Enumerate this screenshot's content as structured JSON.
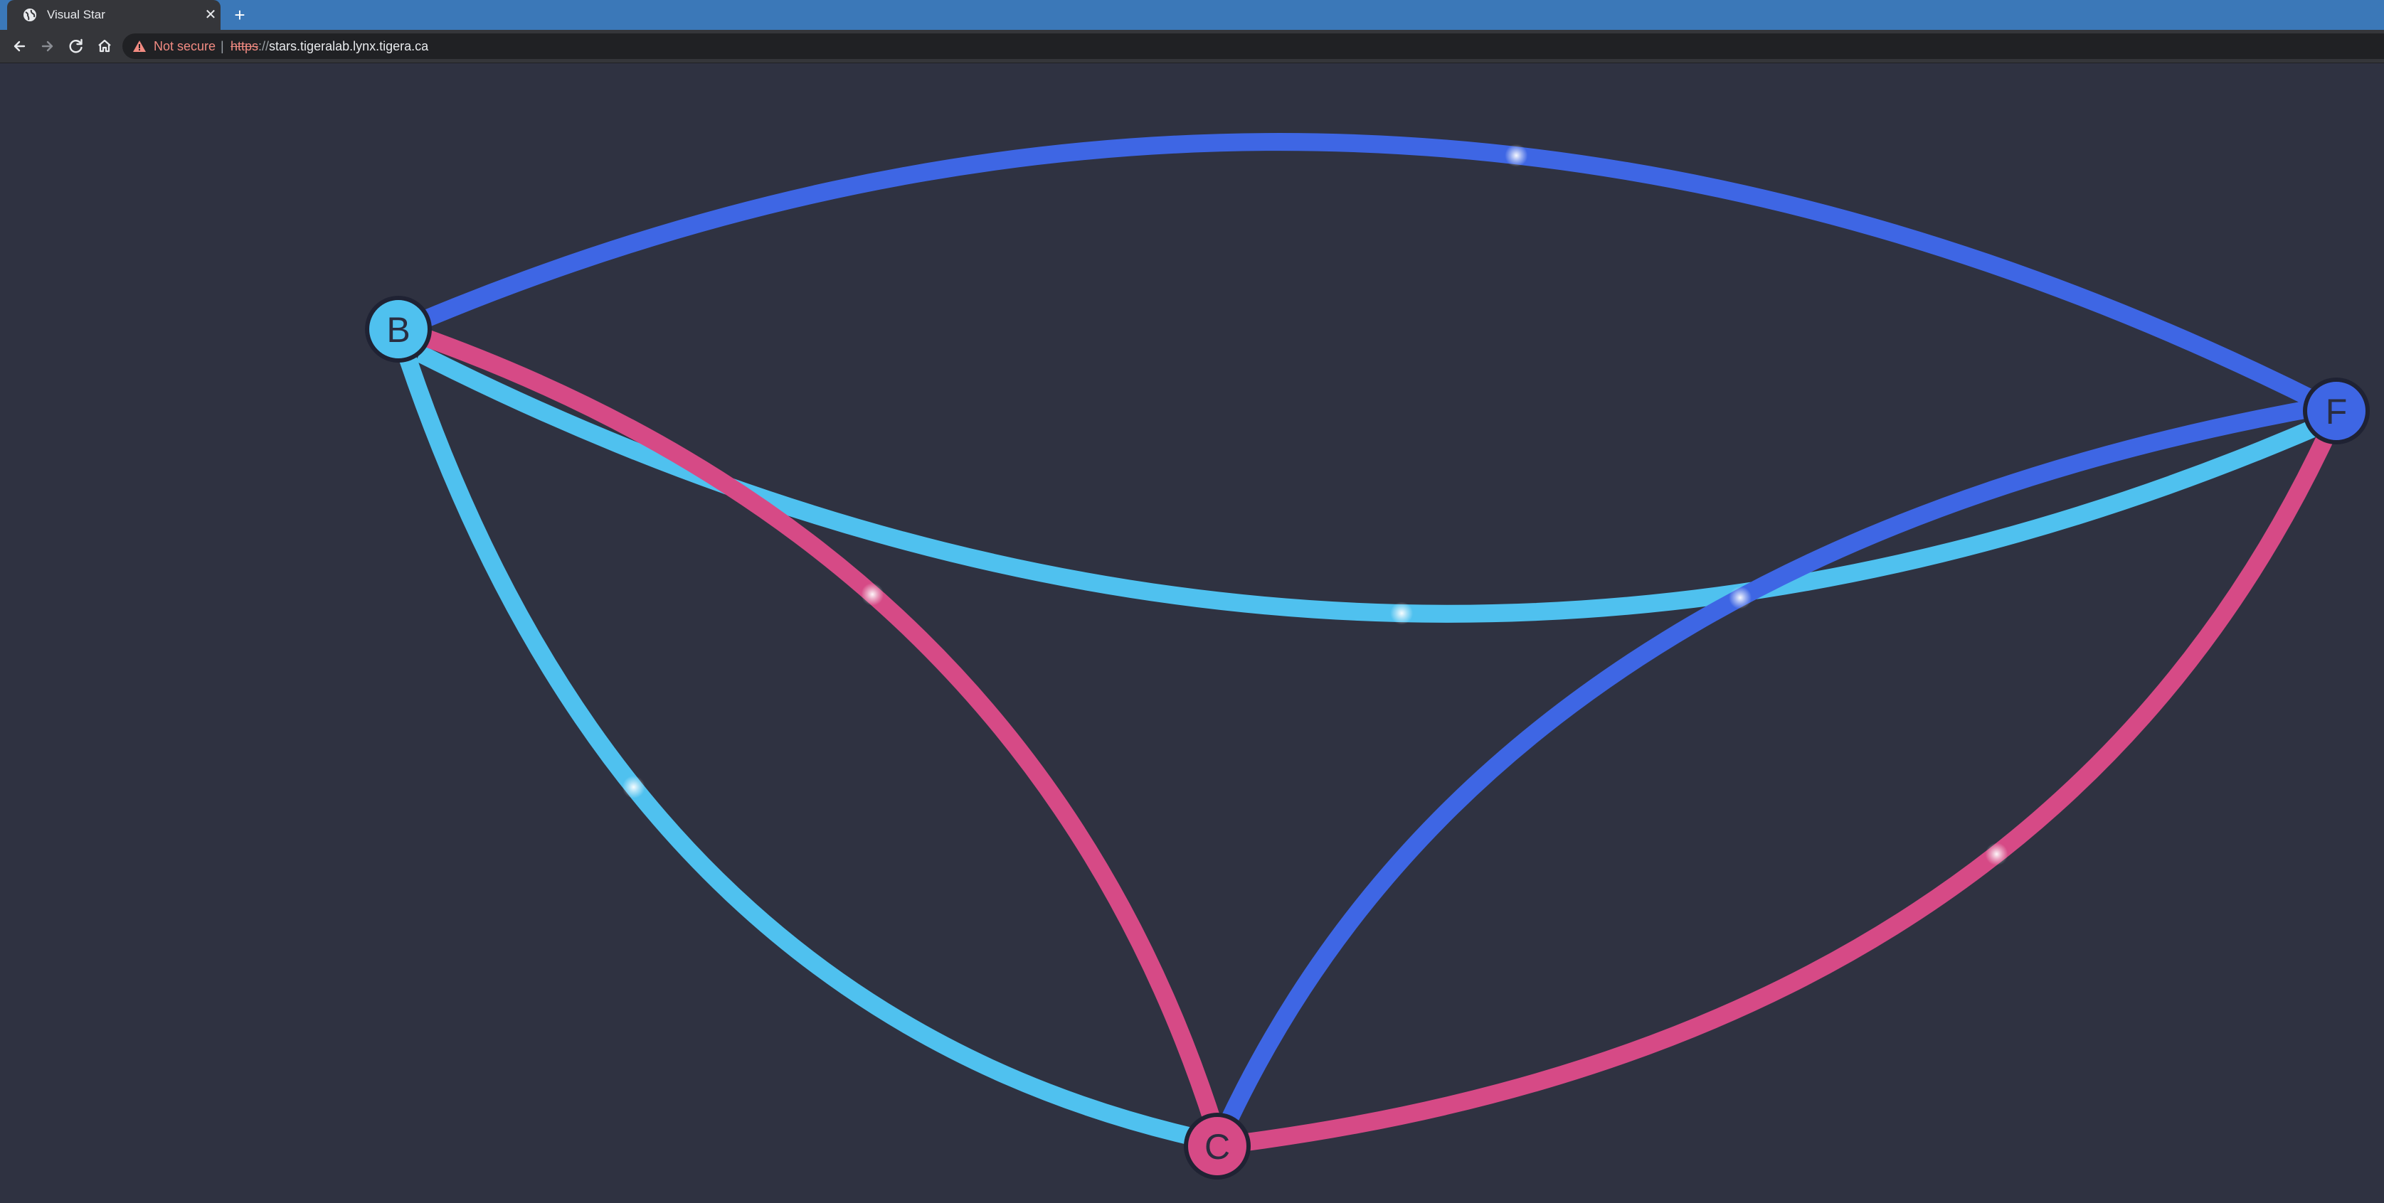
{
  "browser": {
    "tab": {
      "title": "Visual Star",
      "favicon": "globe-icon",
      "close_icon": "close-icon"
    },
    "new_tab_icon": "plus-icon",
    "nav": {
      "back_icon": "arrow-left-icon",
      "forward_icon": "arrow-right-icon",
      "reload_icon": "reload-icon",
      "home_icon": "home-icon"
    },
    "address_bar": {
      "security_icon": "warning-triangle-icon",
      "security_text": "Not secure",
      "separator": "|",
      "scheme": "https",
      "scheme_sep": "://",
      "host": "stars.tigeralab.lynx.tigera.ca"
    }
  },
  "graph": {
    "colors": {
      "background": "#2f3241",
      "light_blue": "#4fc1ef",
      "blue": "#3e66e4",
      "pink": "#d64a86",
      "node_stroke": "#1f2233",
      "label_text": "#2a2d40"
    },
    "nodes": [
      {
        "id": "B",
        "label": "B",
        "color": "light_blue"
      },
      {
        "id": "F",
        "label": "F",
        "color": "blue"
      },
      {
        "id": "C",
        "label": "C",
        "color": "pink"
      }
    ],
    "edges": [
      {
        "from": "B",
        "to": "F",
        "color": "blue"
      },
      {
        "from": "B",
        "to": "F",
        "color": "light_blue"
      },
      {
        "from": "B",
        "to": "C",
        "color": "pink"
      },
      {
        "from": "B",
        "to": "C",
        "color": "light_blue"
      },
      {
        "from": "F",
        "to": "C",
        "color": "blue"
      },
      {
        "from": "F",
        "to": "C",
        "color": "pink"
      }
    ]
  }
}
